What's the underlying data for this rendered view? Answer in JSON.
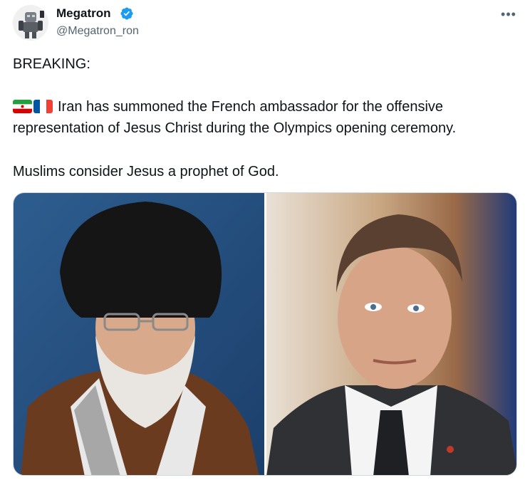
{
  "user": {
    "display_name": "Megatron",
    "handle": "@Megatron_ron",
    "avatar_icon": "robot-avatar",
    "verified_icon": "verified-badge-icon",
    "verified_color": "#1d9bf0"
  },
  "menu_icon": "more-options-icon",
  "tweet": {
    "line1": "BREAKING:",
    "flags": [
      "iran-flag-icon",
      "france-flag-icon"
    ],
    "line2": "Iran has summoned the French ambassador for the offensive",
    "line3": "representation of Jesus Christ during the Olympics opening ceremony.",
    "line4": "Muslims consider Jesus a prophet of God."
  },
  "media": {
    "images": [
      "portrait-cleric",
      "portrait-politician"
    ]
  },
  "colors": {
    "text_primary": "#0f1419",
    "text_secondary": "#536471",
    "border": "#cfd9de"
  }
}
